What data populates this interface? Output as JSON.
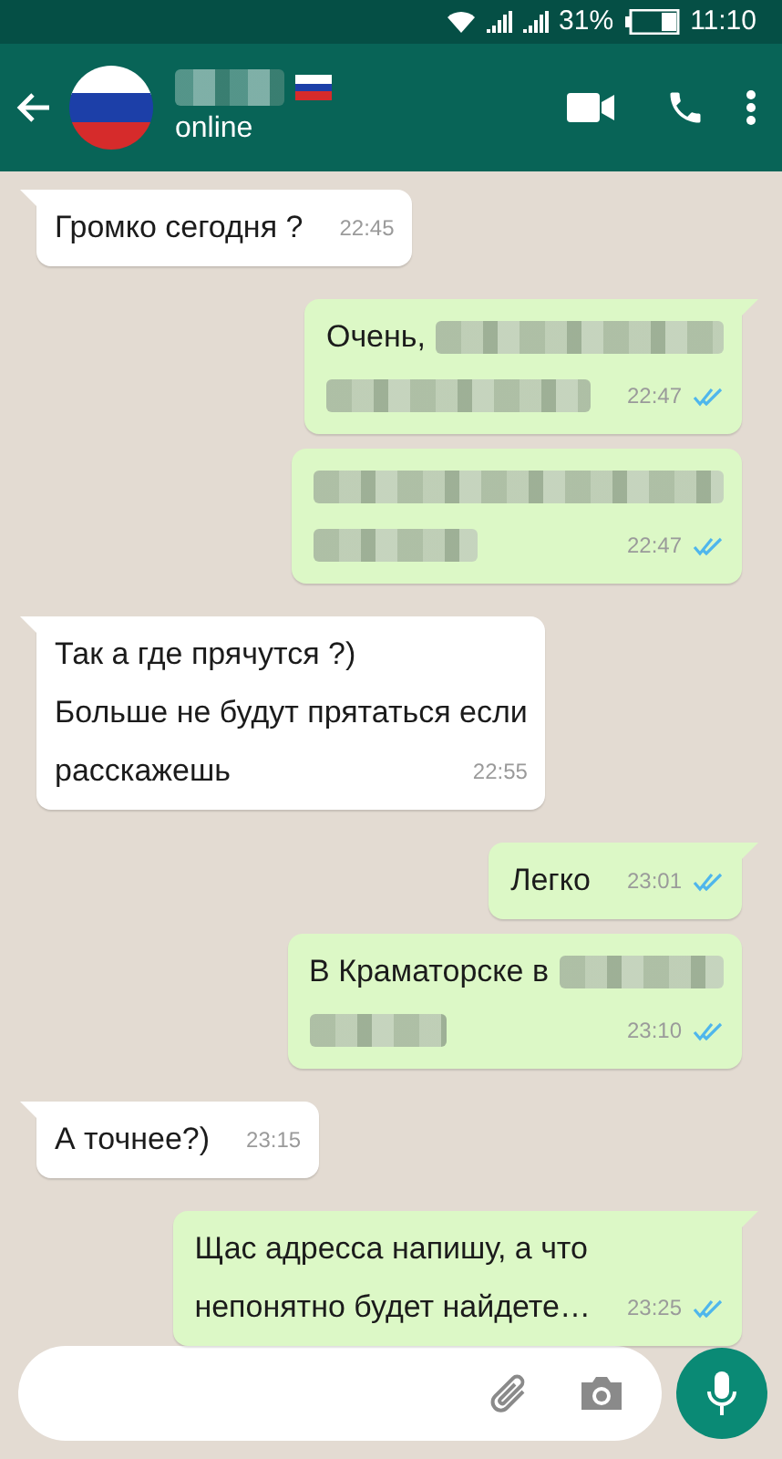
{
  "status_bar": {
    "battery": "31%",
    "time": "11:10"
  },
  "header": {
    "name": {
      "kind": "redacted"
    },
    "status": "online"
  },
  "messages": [
    {
      "kind": "incoming",
      "lines": [
        [
          {
            "kind": "text",
            "text": "Громко сегодня ?"
          }
        ]
      ],
      "time": "22:45"
    },
    {
      "kind": "outgoing",
      "lines": [
        [
          {
            "kind": "text",
            "text": "Очень,"
          },
          {
            "kind": "redacted"
          }
        ],
        [
          {
            "kind": "redacted"
          }
        ]
      ],
      "time": "22:47",
      "read": true
    },
    {
      "kind": "outgoing",
      "lines": [
        [
          {
            "kind": "redacted"
          }
        ],
        [
          {
            "kind": "redacted"
          }
        ]
      ],
      "time": "22:47",
      "read": true
    },
    {
      "kind": "incoming",
      "lines": [
        [
          {
            "kind": "text",
            "text": "Так а где прячутся ?)"
          }
        ],
        [
          {
            "kind": "text",
            "text": "Больше не будут прятаться если"
          }
        ],
        [
          {
            "kind": "text",
            "text": "расскажешь"
          }
        ]
      ],
      "time": "22:55"
    },
    {
      "kind": "outgoing",
      "lines": [
        [
          {
            "kind": "text",
            "text": "Легко"
          }
        ]
      ],
      "time": "23:01",
      "read": true
    },
    {
      "kind": "outgoing",
      "lines": [
        [
          {
            "kind": "text",
            "text": "В Краматорске в"
          },
          {
            "kind": "redacted"
          }
        ],
        [
          {
            "kind": "redacted"
          }
        ]
      ],
      "time": "23:10",
      "read": true
    },
    {
      "kind": "incoming",
      "lines": [
        [
          {
            "kind": "text",
            "text": "А точнее?)"
          }
        ]
      ],
      "time": "23:15"
    },
    {
      "kind": "outgoing",
      "lines": [
        [
          {
            "kind": "text",
            "text": "Щас адресса напишу, а что"
          }
        ],
        [
          {
            "kind": "text",
            "text": "непонятно будет найдете…"
          }
        ]
      ],
      "time": "23:25",
      "read": true
    }
  ]
}
